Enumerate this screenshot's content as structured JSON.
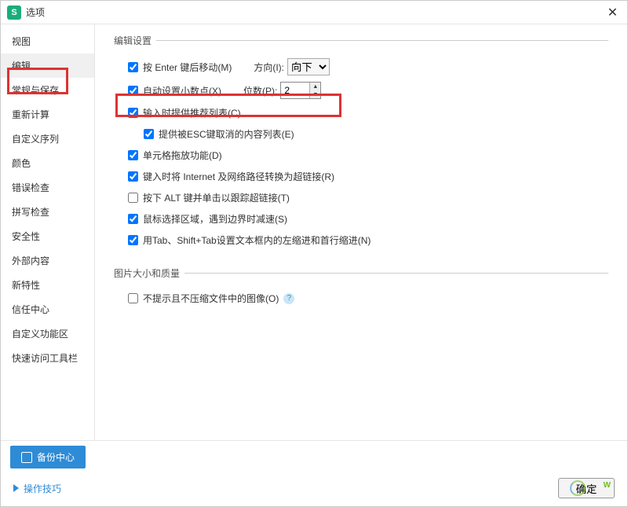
{
  "title": "选项",
  "sidebar": {
    "items": [
      {
        "label": "视图"
      },
      {
        "label": "编辑"
      },
      {
        "label": "常规与保存"
      },
      {
        "label": "重新计算"
      },
      {
        "label": "自定义序列"
      },
      {
        "label": "颜色"
      },
      {
        "label": "错误检查"
      },
      {
        "label": "拼写检查"
      },
      {
        "label": "安全性"
      },
      {
        "label": "外部内容"
      },
      {
        "label": "新特性"
      },
      {
        "label": "信任中心"
      },
      {
        "label": "自定义功能区"
      },
      {
        "label": "快速访问工具栏"
      }
    ],
    "active_index": 1
  },
  "sections": {
    "edit": {
      "legend": "编辑设置",
      "enter_move": {
        "checked": true,
        "label": "按 Enter 键后移动(M)"
      },
      "direction_label": "方向(I):",
      "direction_value": "向下",
      "auto_decimal": {
        "checked": true,
        "label": "自动设置小数点(X)"
      },
      "digits_label": "位数(P):",
      "digits_value": "2",
      "input_suggest": {
        "checked": true,
        "label": "输入时提供推荐列表(C)"
      },
      "esc_list": {
        "checked": true,
        "label": "提供被ESC键取消的内容列表(E)"
      },
      "drag_drop": {
        "checked": true,
        "label": "单元格拖放功能(D)"
      },
      "hyperlink": {
        "checked": true,
        "label": "键入时将 Internet 及网络路径转换为超链接(R)"
      },
      "alt_track": {
        "checked": false,
        "label": "按下 ALT 键并单击以跟踪超链接(T)"
      },
      "mouse_slow": {
        "checked": true,
        "label": "鼠标选择区域，遇到边界时减速(S)"
      },
      "tab_indent": {
        "checked": true,
        "label": "用Tab、Shift+Tab设置文本框内的左缩进和首行缩进(N)"
      }
    },
    "image": {
      "legend": "图片大小和质量",
      "no_compress": {
        "checked": false,
        "label": "不提示且不压缩文件中的图像(O)"
      }
    }
  },
  "footer": {
    "backup_label": "备份中心",
    "tips_label": "操作技巧",
    "ok_label": "确定"
  }
}
